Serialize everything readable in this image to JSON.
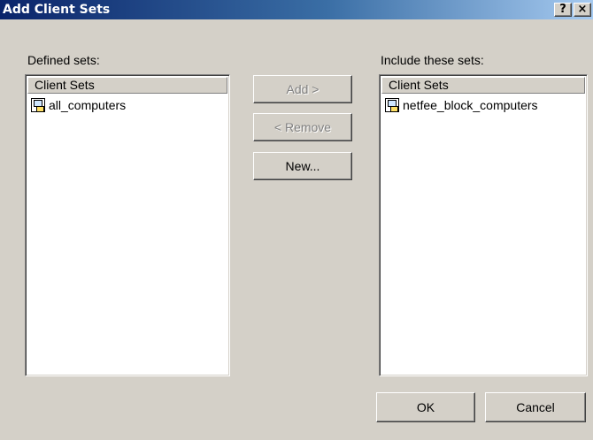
{
  "window": {
    "title": "Add Client Sets",
    "help_glyph": "?",
    "close_glyph": "×"
  },
  "defined": {
    "label": "Defined sets:",
    "column_header": "Client Sets",
    "items": [
      {
        "label": "all_computers",
        "icon": "client-set-icon"
      }
    ]
  },
  "include": {
    "label": "Include these sets:",
    "column_header": "Client Sets",
    "items": [
      {
        "label": "netfee_block_computers",
        "icon": "client-set-icon"
      }
    ]
  },
  "buttons": {
    "add": "Add >",
    "remove": "< Remove",
    "new": "New...",
    "ok": "OK",
    "cancel": "Cancel"
  },
  "states": {
    "add_enabled": false,
    "remove_enabled": false,
    "new_enabled": true
  }
}
